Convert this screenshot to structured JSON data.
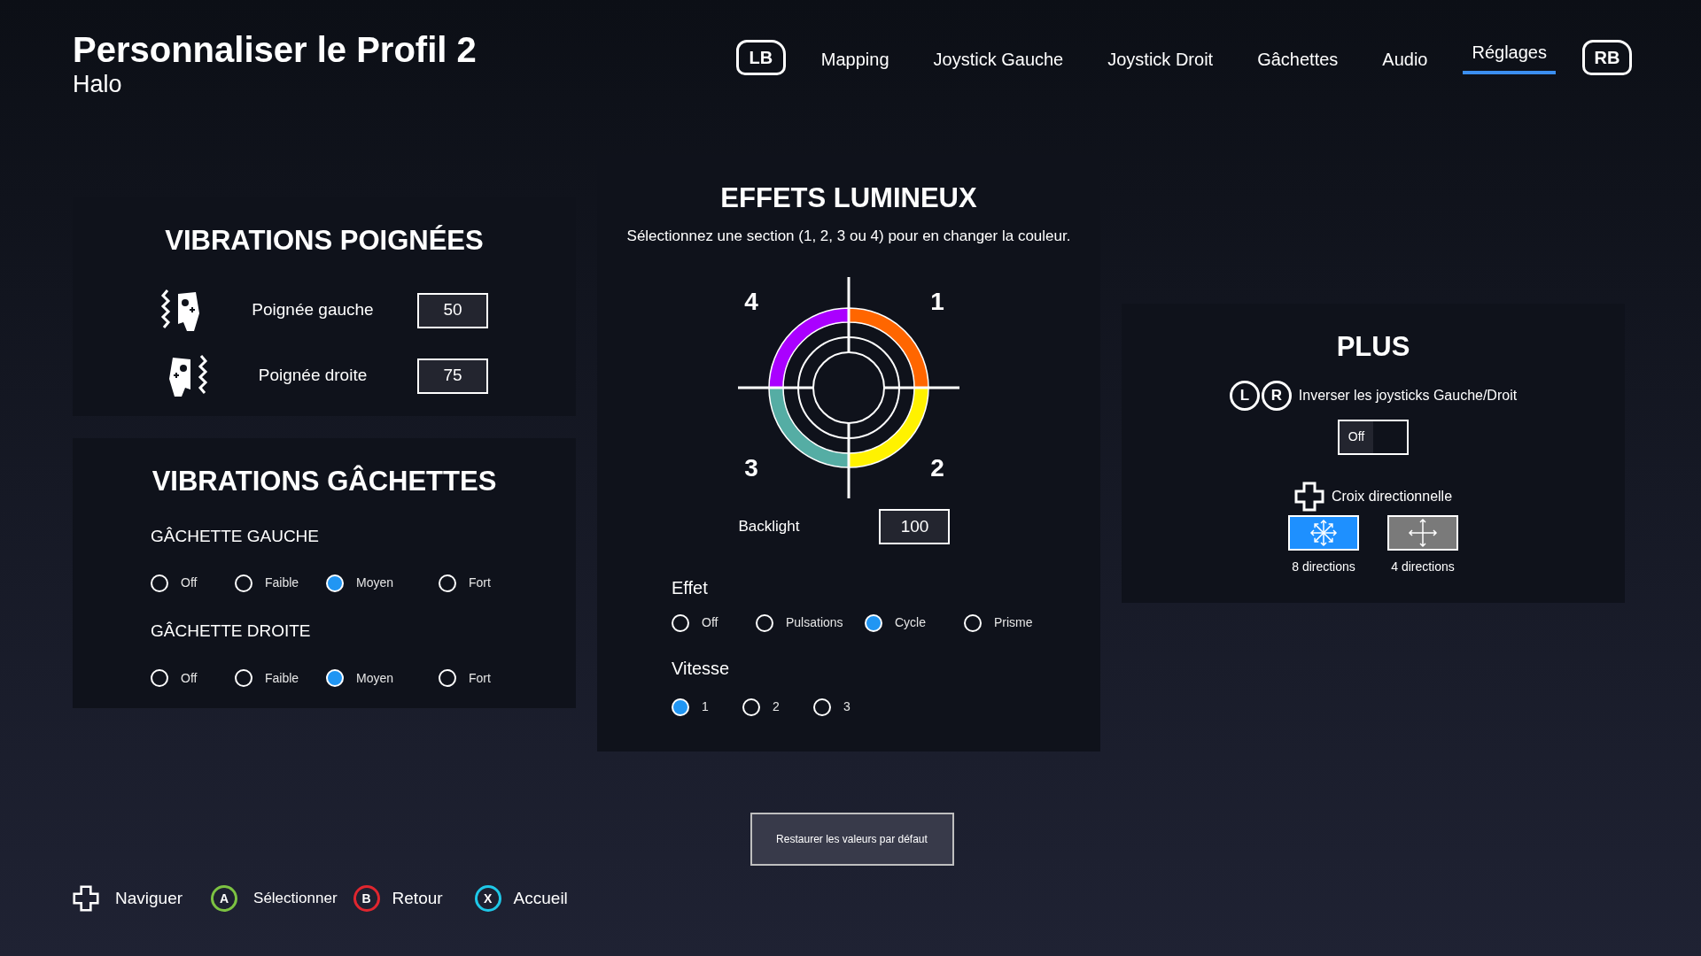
{
  "header": {
    "title": "Personnaliser le Profil 2",
    "subtitle": "Halo"
  },
  "nav": {
    "left_bumper": "LB",
    "right_bumper": "RB",
    "tabs": [
      {
        "label": "Mapping",
        "selected": false
      },
      {
        "label": "Joystick Gauche",
        "selected": false
      },
      {
        "label": "Joystick Droit",
        "selected": false
      },
      {
        "label": "Gâchettes",
        "selected": false
      },
      {
        "label": "Audio",
        "selected": false
      },
      {
        "label": "Réglages",
        "selected": true
      }
    ]
  },
  "grip_vibration": {
    "title": "VIBRATIONS POIGNÉES",
    "rows": [
      {
        "kind": "left",
        "label": "Poignée gauche",
        "value": "50"
      },
      {
        "kind": "right",
        "label": "Poignée droite",
        "value": "75"
      }
    ]
  },
  "trigger_vibration": {
    "title": "VIBRATIONS GÂCHETTES",
    "groups": [
      {
        "label": "GÂCHETTE GAUCHE",
        "options": [
          {
            "label": "Off",
            "selected": false
          },
          {
            "label": "Faible",
            "selected": false
          },
          {
            "label": "Moyen",
            "selected": true
          },
          {
            "label": "Fort",
            "selected": false
          }
        ]
      },
      {
        "label": "GÂCHETTE DROITE",
        "options": [
          {
            "label": "Off",
            "selected": false
          },
          {
            "label": "Faible",
            "selected": false
          },
          {
            "label": "Moyen",
            "selected": true
          },
          {
            "label": "Fort",
            "selected": false
          }
        ]
      }
    ]
  },
  "light_effects": {
    "title": "EFFETS LUMINEUX",
    "hint": "Sélectionnez une section (1, 2, 3 ou 4) pour en changer la couleur.",
    "sections": [
      {
        "label": "4",
        "color": "#aa00ff"
      },
      {
        "label": "1",
        "color": "#ff6600"
      },
      {
        "label": "3",
        "color": "#55ada4"
      },
      {
        "label": "2",
        "color": "#fff200"
      }
    ],
    "backlight": {
      "label": "Backlight",
      "value": "100"
    },
    "effect": {
      "label": "Effet",
      "options": [
        {
          "label": "Off",
          "selected": false
        },
        {
          "label": "Pulsations",
          "selected": false
        },
        {
          "label": "Cycle",
          "selected": true
        },
        {
          "label": "Prisme",
          "selected": false
        }
      ]
    },
    "speed": {
      "label": "Vitesse",
      "options": [
        {
          "label": "1",
          "selected": true
        },
        {
          "label": "2",
          "selected": false
        },
        {
          "label": "3",
          "selected": false
        }
      ]
    }
  },
  "more": {
    "title": "PLUS",
    "swap": {
      "keys": [
        "L",
        "R"
      ],
      "label": "Inverser les joysticks Gauche/Droit",
      "toggle": {
        "label": "Off",
        "on": false
      }
    },
    "dpad": {
      "label": "Croix directionnelle",
      "modes": [
        {
          "kind": "eight",
          "label": "8 directions",
          "selected": true
        },
        {
          "kind": "four",
          "label": "4 directions",
          "selected": false
        }
      ]
    }
  },
  "restore_button": "Restaurer les valeurs par défaut",
  "footer": [
    {
      "kind": "dpad",
      "label": "Naviguer"
    },
    {
      "kind": "button",
      "key": "A",
      "color": "#7cc242",
      "label": "Sélectionner"
    },
    {
      "kind": "button",
      "key": "B",
      "color": "#e0262f",
      "label": "Retour"
    },
    {
      "kind": "button",
      "key": "X",
      "color": "#1ec8e8",
      "label": "Accueil"
    }
  ]
}
